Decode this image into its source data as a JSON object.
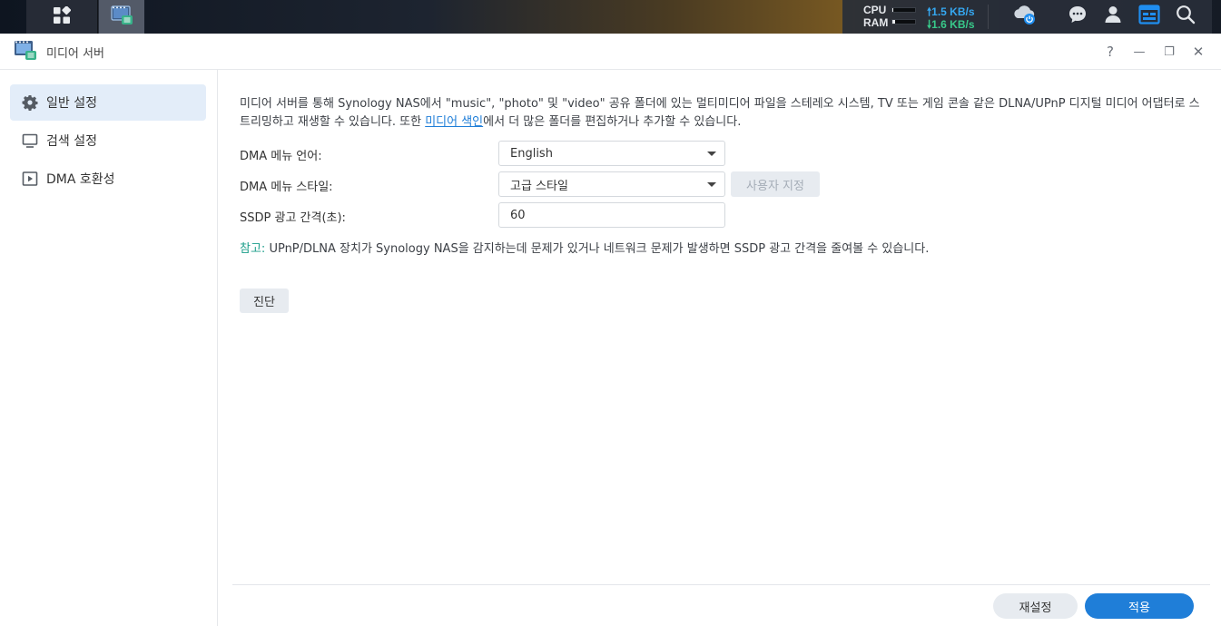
{
  "taskbar": {
    "icons": {
      "main_menu": "grid-icon",
      "media_server": "media-server-icon",
      "cloud": "cloud-power-icon",
      "messages": "chat-icon",
      "user": "user-icon",
      "widgets": "widget-icon",
      "search": "search-icon"
    },
    "resource_monitor": {
      "cpu_label": "CPU",
      "ram_label": "RAM",
      "cpu_usage": 0.05,
      "ram_usage": 0.1,
      "upload": "1.5 KB/s",
      "download": "1.6 KB/s"
    }
  },
  "window": {
    "title": "미디어 서버",
    "controls": {
      "help": "?",
      "minimize": "—",
      "restore": "❐",
      "close": "✕"
    }
  },
  "sidebar": {
    "items": [
      {
        "label": "일반 설정",
        "icon": "gear-icon",
        "selected": true
      },
      {
        "label": "검색 설정",
        "icon": "monitor-icon",
        "selected": false
      },
      {
        "label": "DMA 호환성",
        "icon": "play-icon",
        "selected": false
      }
    ]
  },
  "main": {
    "description_part1": "미디어 서버를 통해 Synology NAS에서 \"music\", \"photo\" 및 \"video\" 공유 폴더에 있는 멀티미디어 파일을 스테레오 시스템, TV 또는 게임 콘솔 같은 DLNA/UPnP 디지털 미디어 어댑터로 스트리밍하고 재생할 수 있습니다. 또한 ",
    "description_link": "미디어 색인",
    "description_part2": "에서 더 많은 폴더를 편집하거나 추가할 수 있습니다.",
    "fields": {
      "language_label": "DMA 메뉴 언어:",
      "language_value": "English",
      "style_label": "DMA 메뉴 스타일:",
      "style_value": "고급 스타일",
      "custom_button": "사용자 지정",
      "ssdp_label": "SSDP 광고 간격(초):",
      "ssdp_value": "60"
    },
    "note_tag": "참고:",
    "note_text": " UPnP/DLNA 장치가 Synology NAS을 감지하는데 문제가 있거나 네트워크 문제가 발생하면 SSDP 광고 간격을 줄여볼 수 있습니다.",
    "diagnose_button": "진단"
  },
  "footer": {
    "reset_button": "재설정",
    "apply_button": "적용"
  },
  "colors": {
    "accent": "#1f7ed8",
    "note_tag": "#1b9e8a",
    "selected_bg": "#e3edf9"
  }
}
